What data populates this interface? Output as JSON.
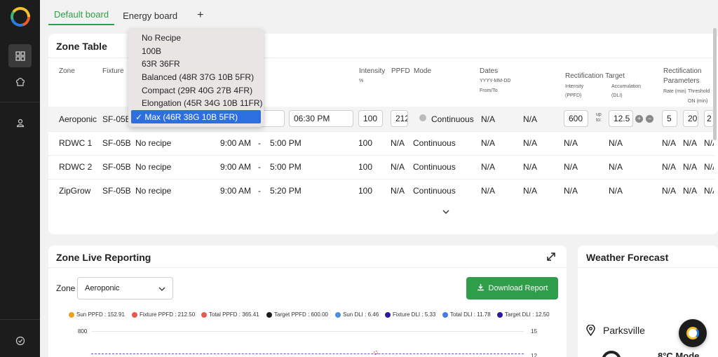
{
  "tabs": [
    {
      "label": "Default board"
    },
    {
      "label": "Energy board"
    }
  ],
  "tab_add_label": "+",
  "zone_table": {
    "title": "Zone Table",
    "headers": {
      "zone": "Zone",
      "fixture": "Fixture",
      "intensity": "Intensity",
      "intensity_unit": "%",
      "ppfd": "PPFD",
      "mode": "Mode",
      "dates": "Dates",
      "dates_format": "YYYY-MM-DD",
      "dates_from_to": "From/To",
      "rect_target": "Rectification Target",
      "rect_intensity": "Intensity",
      "rect_ppfd": "(PPFD)",
      "rect_accumulation": "Accumulation",
      "rect_dli": "(DLI)",
      "rect_params_1": "Rectification",
      "rect_params_2": "Parameters",
      "rate": "Rate (min)",
      "threshold": "Threshold",
      "on_min": "ON (min)"
    },
    "active_row": {
      "zone": "Aeroponic",
      "fixture": "SF-05B",
      "end_time": "06:30 PM",
      "intensity": "100",
      "ppfd": "212",
      "mode": "Continuous",
      "date_from": "N/A",
      "date_to": "N/A",
      "target_intensity": "600",
      "up_to_1": "up",
      "up_to_2": "to:",
      "target_dli": "12.5",
      "plus": "+",
      "minus": "−",
      "rate": "5",
      "threshold": "20",
      "on_min": "2"
    },
    "rows": [
      {
        "zone": "RDWC 1",
        "fixture": "SF-05B",
        "recipe": "No recipe",
        "start": "9:00 AM",
        "dash": "-",
        "end": "5:00 PM",
        "intensity": "100",
        "ppfd": "N/A",
        "mode": "Continuous",
        "date_from": "N/A",
        "date_to": "N/A",
        "target_intensity": "N/A",
        "target_dli": "N/A",
        "rate": "N/A",
        "threshold": "N/A",
        "on_min": "N/A"
      },
      {
        "zone": "RDWC 2",
        "fixture": "SF-05B",
        "recipe": "No recipe",
        "start": "9:00 AM",
        "dash": "-",
        "end": "5:00 PM",
        "intensity": "100",
        "ppfd": "N/A",
        "mode": "Continuous",
        "date_from": "N/A",
        "date_to": "N/A",
        "target_intensity": "N/A",
        "target_dli": "N/A",
        "rate": "N/A",
        "threshold": "N/A",
        "on_min": "N/A"
      },
      {
        "zone": "ZipGrow",
        "fixture": "SF-05B",
        "recipe": "No recipe",
        "start": "9:00 AM",
        "dash": "-",
        "end": "5:20 PM",
        "intensity": "100",
        "ppfd": "N/A",
        "mode": "Continuous",
        "date_from": "N/A",
        "date_to": "N/A",
        "target_intensity": "N/A",
        "target_dli": "N/A",
        "rate": "N/A",
        "threshold": "N/A",
        "on_min": "N/A"
      }
    ]
  },
  "recipe_dropdown": {
    "options": [
      "No Recipe",
      "100B",
      "63R 36FR",
      "Balanced (48R 37G 10B 5FR)",
      "Compact (29R 40G 27B 4FR)",
      "Elongation (45R 34G 10B 11FR)"
    ],
    "selected": "✓ Max (46R 38G 10B 5FR)"
  },
  "live_reporting": {
    "title": "Zone Live Reporting",
    "zone_label": "Zone",
    "zone_value": "Aeroponic",
    "download_label": "Download Report",
    "legend": [
      {
        "label": "Sun PPFD : 152.91",
        "color": "#e8a31c"
      },
      {
        "label": "Fixture PPFD : 212.50",
        "color": "#e85a4f"
      },
      {
        "label": "Total PPFD : 365.41",
        "color": "#e85a4f"
      },
      {
        "label": "Target PPFD : 600.00",
        "color": "#1a1a1a"
      },
      {
        "label": "Sun DLI : 6.46",
        "color": "#4a90e2"
      },
      {
        "label": "Fixture DLI : 5.33",
        "color": "#2a1a9e"
      },
      {
        "label": "Total DLI : 11.78",
        "color": "#4a7be2"
      },
      {
        "label": "Target DLI : 12.50",
        "color": "#2a1a9e"
      }
    ],
    "y_left_top": "800",
    "y_right_top": "15",
    "y_right_second": "12"
  },
  "weather": {
    "title": "Weather Forecast",
    "location": "Parksville",
    "temp_partial": "8°C  Mode"
  }
}
